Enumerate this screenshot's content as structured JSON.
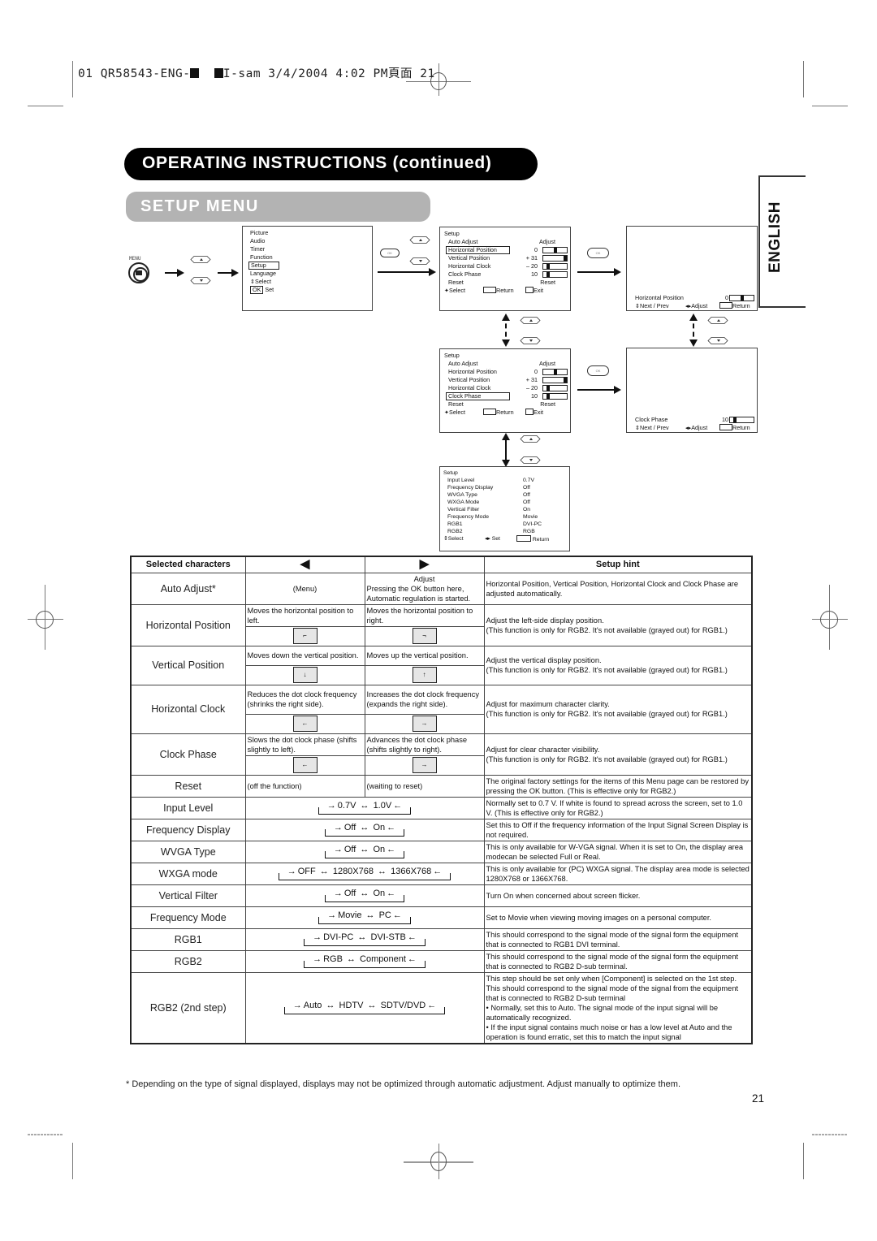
{
  "slug": {
    "prefix": "01 QR58543-ENG-",
    "middle": "I-sam 3/4/2004 4:02 PM",
    "cjk": "頁面",
    "page": "21"
  },
  "header": {
    "section_title": "OPERATING INSTRUCTIONS (continued)",
    "subsection_title": "SETUP MENU",
    "language_tab": "ENGLISH"
  },
  "diagram": {
    "menu_button_label": "MENU",
    "ok_label": "OK",
    "main_menu": {
      "items": [
        "Picture",
        "Audio",
        "Timer",
        "Function",
        "Setup",
        "Language"
      ],
      "selected": "Setup",
      "footer_select": "Select",
      "footer_ok_key": "OK",
      "footer_set": "Set"
    },
    "setup_menu_1": {
      "title": "Setup",
      "header_value": "Adjust",
      "rows": [
        {
          "label": "Auto Adjust",
          "value": "Adjust"
        },
        {
          "label": "Horizontal Position",
          "value": "0",
          "bar": 0.5
        },
        {
          "label": "Vertical Position",
          "value": "+ 31",
          "bar": 1.0
        },
        {
          "label": "Horizontal Clock",
          "value": "– 20",
          "bar": 0.15
        },
        {
          "label": "Clock Phase",
          "value": "10",
          "bar": 0.15
        },
        {
          "label": "Reset",
          "value": "Reset"
        }
      ],
      "selected": "Horizontal Position",
      "footer_select": "Select",
      "footer_return": "Return",
      "footer_exit": "Exit"
    },
    "setup_menu_2": {
      "selected": "Clock Phase"
    },
    "adjust_hpos": {
      "label": "Horizontal Position",
      "value": "0",
      "bar": 0.5,
      "footer_next": "Next / Prev",
      "footer_adjust": "Adjust",
      "footer_return": "Return"
    },
    "adjust_clock": {
      "label": "Clock Phase",
      "value": "10",
      "bar": 0.15,
      "footer_next": "Next / Prev",
      "footer_adjust": "Adjust",
      "footer_return": "Return"
    },
    "setup_menu_page2": {
      "title": "Setup",
      "rows": [
        {
          "label": "Input Level",
          "value": "0.7V"
        },
        {
          "label": "Frequency Display",
          "value": "Off"
        },
        {
          "label": "WVGA Type",
          "value": "Off"
        },
        {
          "label": "WXGA Mode",
          "value": "Off"
        },
        {
          "label": "Vertical Filter",
          "value": "On"
        },
        {
          "label": "Frequency Mode",
          "value": "Movie"
        },
        {
          "label": "RGB1",
          "value": "DVI-PC"
        },
        {
          "label": "RGB2",
          "value": "RGB"
        }
      ],
      "footer_select": "Select",
      "footer_set": "Set",
      "footer_return": "Return"
    }
  },
  "table": {
    "headers": {
      "selected": "Selected characters",
      "left": "◀",
      "right": "▶",
      "hint": "Setup hint"
    },
    "rows": [
      {
        "name": "Auto Adjust*",
        "left": "(Menu)",
        "right_title": "Adjust",
        "right": "Pressing the OK button here, Automatic regulation is started.",
        "hint": "Horizontal Position, Vertical Position, Horizontal Clock and Clock Phase are adjusted automatically."
      },
      {
        "name": "Horizontal Position",
        "left": "Moves the horizontal position to left.",
        "right": "Moves the horizontal position to right.",
        "left_icon": "⌐",
        "right_icon": "¬",
        "hint1": "Adjust the left-side display position.",
        "hint2": "(This function is only for RGB2. It's not available (grayed out) for RGB1.)"
      },
      {
        "name": "Vertical Position",
        "left": "Moves down the vertical position.",
        "right": "Moves up the vertical position.",
        "left_icon": "↓",
        "right_icon": "↑",
        "hint1": "Adjust the vertical display position.",
        "hint2": "(This function is only for RGB2. It's not available (grayed out) for RGB1.)"
      },
      {
        "name": "Horizontal Clock",
        "left": "Reduces the dot clock frequency (shrinks the right side).",
        "right": "Increases the dot clock frequency (expands the right side).",
        "left_icon": "←",
        "right_icon": "→",
        "hint1": "Adjust for maximum character clarity.",
        "hint2": "(This function is only for RGB2. It's not available (grayed out) for RGB1.)"
      },
      {
        "name": "Clock Phase",
        "left": "Slows the dot clock phase (shifts slightly to left).",
        "right": "Advances the dot clock phase (shifts slightly to right).",
        "left_icon": "←",
        "right_icon": "→",
        "hint1": "Adjust for clear character visibility.",
        "hint2": "(This function is only for RGB2. It's not available (grayed out) for RGB1.)"
      },
      {
        "name": "Reset",
        "left": "(off the function)",
        "right": "(waiting to reset)",
        "hint": "The original factory settings for the items of this Menu page can be restored by pressing the OK button. (This is effective only for RGB2.)"
      }
    ],
    "cycle_rows": [
      {
        "name": "Input Level",
        "options": [
          "0.7V",
          "1.0V"
        ],
        "hint": "Normally set to 0.7 V. If white is found to spread across the screen, set to 1.0 V. (This is effective only for RGB2.)"
      },
      {
        "name": "Frequency Display",
        "options": [
          "Off",
          "On"
        ],
        "hint": "Set this to Off if the frequency information of the Input Signal Screen Display is not required."
      },
      {
        "name": "WVGA Type",
        "options": [
          "Off",
          "On"
        ],
        "hint": "This is only available for W-VGA signal. When it is set to On, the display area modecan be selected Full or Real."
      },
      {
        "name": "WXGA mode",
        "options": [
          "OFF",
          "1280X768",
          "1366X768"
        ],
        "hint": "This is only available for (PC) WXGA signal. The display area mode is selected 1280X768 or 1366X768."
      },
      {
        "name": "Vertical Filter",
        "options": [
          "Off",
          "On"
        ],
        "hint": "Turn On when concerned about screen flicker."
      },
      {
        "name": "Frequency Mode",
        "options": [
          "Movie",
          "PC"
        ],
        "hint": "Set to Movie when viewing moving images on a personal computer."
      },
      {
        "name": "RGB1",
        "options": [
          "DVI-PC",
          "DVI-STB"
        ],
        "hint": "This should correspond to the signal mode of the signal form the equipment that is connected to RGB1 DVI terminal."
      },
      {
        "name": "RGB2",
        "options": [
          "RGB",
          "Component"
        ],
        "hint": "This should correspond to the signal mode of the signal form the equipment that is connected to RGB2 D-sub terminal."
      }
    ],
    "rgb2_step2": {
      "name": "RGB2 (2nd step)",
      "options": [
        "Auto",
        "HDTV",
        "SDTV/DVD"
      ],
      "hint_lines": [
        "This step should be set only when [Component] is selected on the 1st step.",
        "This should correspond to the signal mode of the signal from the equipment that is connected to RGB2 D-sub terminal",
        "• Normally, set this to Auto. The signal mode of the input signal will be automatically recognized.",
        "• If the input signal contains much noise or has a low level at Auto and the operation is found erratic, set this to match the input signal"
      ]
    }
  },
  "footnote": "*  Depending on the type of signal displayed, displays may not be optimized through automatic adjustment. Adjust manually to optimize them.",
  "page_number": "21"
}
